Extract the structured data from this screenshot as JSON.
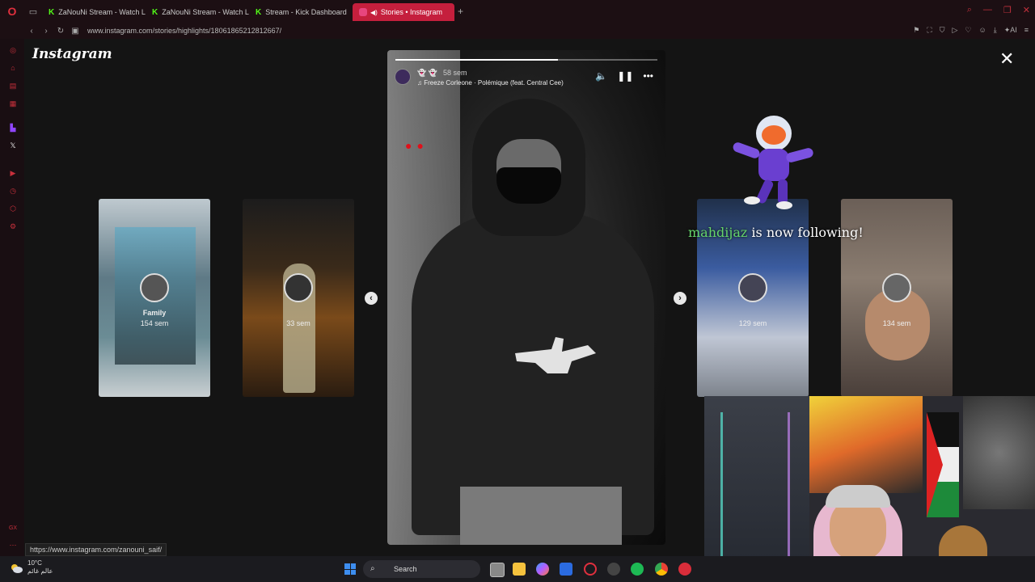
{
  "browser": {
    "tabs": [
      {
        "label": "ZaNouNi Stream - Watch L",
        "icon": "kick-icon"
      },
      {
        "label": "ZaNouNi Stream - Watch L",
        "icon": "kick-icon"
      },
      {
        "label": "Stream - Kick Dashboard",
        "icon": "kick-icon"
      },
      {
        "label": "Stories • Instagram",
        "icon": "instagram-icon"
      }
    ],
    "url": "www.instagram.com/stories/highlights/18061865212812667/",
    "status_url": "https://www.instagram.com/zanouni_saif/"
  },
  "instagram": {
    "logo": "Instagram",
    "story": {
      "time": "58 sem",
      "song": "Freeze Corleone · Polémique (feat. Central Cee)",
      "progress_fraction": 0.62
    },
    "thumbnails": [
      {
        "title": "Family",
        "time": "154 sem"
      },
      {
        "title": "",
        "time": "33 sem"
      },
      {
        "title": "",
        "time": "129 sem"
      },
      {
        "title": "",
        "time": "134 sem"
      }
    ]
  },
  "alert": {
    "username": "mahdijaz",
    "message": "is now following!"
  },
  "taskbar": {
    "temperature": "10°C",
    "weather_text": "عالم غائم",
    "search_label": "Search"
  },
  "colors": {
    "opera_red": "#c51f3d",
    "kick_green": "#53fc18",
    "alert_green": "#65d56b"
  }
}
